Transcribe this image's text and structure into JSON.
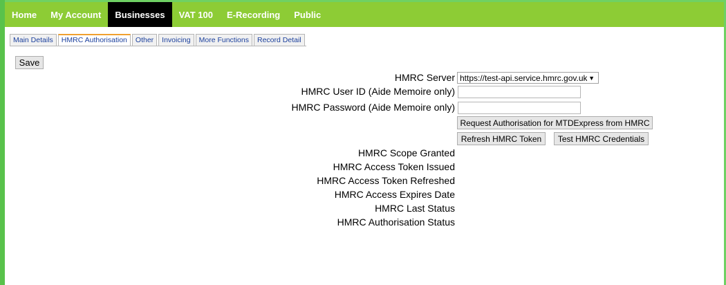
{
  "nav": {
    "items": [
      "Home",
      "My Account",
      "Businesses",
      "VAT 100",
      "E-Recording",
      "Public"
    ],
    "active_index": 2
  },
  "tabs": {
    "items": [
      "Main Details",
      "HMRC Authorisation",
      "Other",
      "Invoicing",
      "More Functions",
      "Record Detail"
    ],
    "active_index": 1
  },
  "toolbar": {
    "save_label": "Save"
  },
  "form": {
    "server_label": "HMRC Server",
    "server_value": "https://test-api.service.hmrc.gov.uk/",
    "user_id_label": "HMRC User ID (Aide Memoire only)",
    "user_id_value": "",
    "password_label": "HMRC Password (Aide Memoire only)",
    "password_value": "",
    "request_auth_label": "Request Authorisation for MTDExpress from HMRC",
    "refresh_token_label": "Refresh HMRC Token",
    "test_credentials_label": "Test HMRC Credentials",
    "scope_granted_label": "HMRC Scope Granted",
    "access_token_issued_label": "HMRC Access Token Issued",
    "access_token_refreshed_label": "HMRC Access Token Refreshed",
    "access_expires_label": "HMRC Access Expires Date",
    "last_status_label": "HMRC Last Status",
    "auth_status_label": "HMRC Authorisation Status"
  },
  "colors": {
    "nav_bg": "#8dcc35",
    "nav_active_bg": "#000000",
    "border_green": "#59c24b",
    "tab_link": "#1a3f9c",
    "tab_active_accent": "#f0a030"
  }
}
